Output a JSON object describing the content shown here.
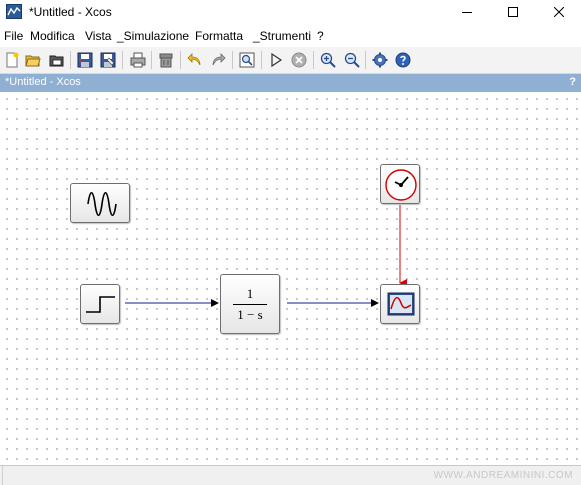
{
  "window": {
    "title": "*Untitled - Xcos",
    "icon": "xcos-app-icon"
  },
  "menu": {
    "items": [
      "File",
      "Modifica",
      "Vista",
      "_Simulazione",
      "Formatta",
      "_Strumenti",
      "?"
    ]
  },
  "toolbar": {
    "buttons": [
      "new-diagram-icon",
      "open-icon",
      "open-in-scilab-icon",
      "save-icon",
      "save-as-icon",
      "print-icon",
      "delete-icon",
      "undo-icon",
      "redo-icon",
      "fit-diagram-icon",
      "start-icon",
      "stop-icon",
      "zoom-in-icon",
      "zoom-out-icon",
      "setup-icon",
      "help-icon"
    ]
  },
  "tab": {
    "title": "*Untitled - Xcos",
    "help": "?"
  },
  "diagram": {
    "blocks": {
      "generator": "sine-wave-generator-block",
      "step": "step-function-block",
      "transfer_function": {
        "numerator": "1",
        "denominator": "1 − s"
      },
      "clock": "clock-block",
      "scope": "scope-block"
    },
    "colors": {
      "regular_link": "#1a1a8c",
      "event_link": "#dd0000",
      "tab_bar": "#8fb0d3"
    }
  },
  "status": {
    "watermark": "WWW.ANDREAMININI.COM"
  }
}
